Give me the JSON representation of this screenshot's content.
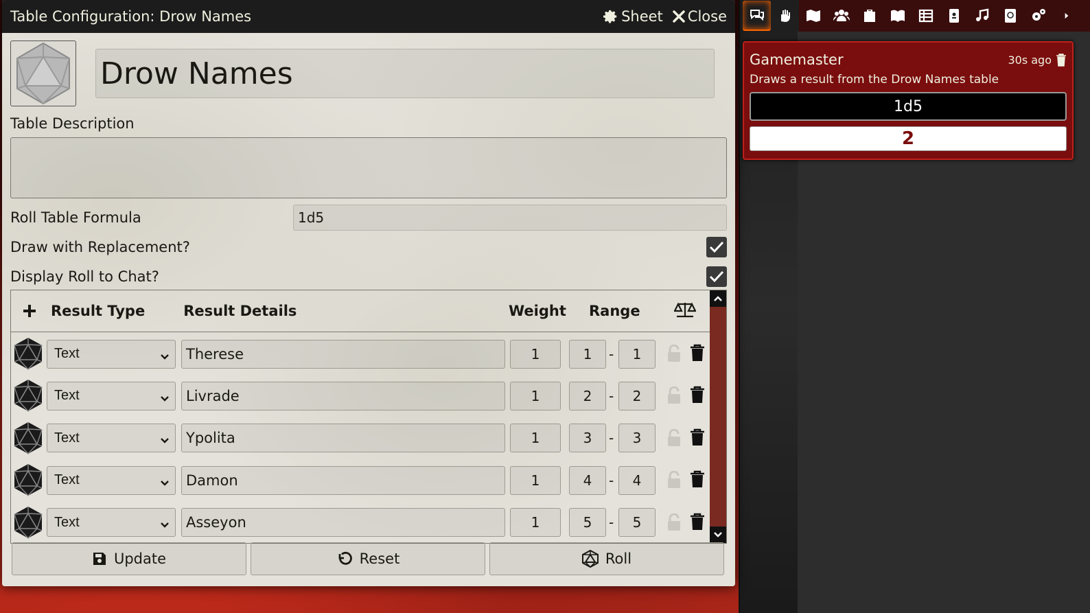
{
  "window": {
    "title": "Table Configuration: Drow Names",
    "sheet_label": "Sheet",
    "close_label": "Close"
  },
  "table": {
    "name": "Drow Names",
    "description_label": "Table Description",
    "description": "",
    "formula_label": "Roll Table Formula",
    "formula": "1d5",
    "replacement_label": "Draw with Replacement?",
    "replacement_checked": true,
    "display_roll_label": "Display Roll to Chat?",
    "display_roll_checked": true
  },
  "results_header": {
    "type": "Result Type",
    "details": "Result Details",
    "weight": "Weight",
    "range": "Range"
  },
  "results": [
    {
      "type": "Text",
      "detail": "Therese",
      "weight": "1",
      "low": "1",
      "high": "1"
    },
    {
      "type": "Text",
      "detail": "Livrade",
      "weight": "1",
      "low": "2",
      "high": "2"
    },
    {
      "type": "Text",
      "detail": "Ypolita",
      "weight": "1",
      "low": "3",
      "high": "3"
    },
    {
      "type": "Text",
      "detail": "Damon",
      "weight": "1",
      "low": "4",
      "high": "4"
    },
    {
      "type": "Text",
      "detail": "Asseyon",
      "weight": "1",
      "low": "5",
      "high": "5"
    }
  ],
  "footer": {
    "update_label": "Update",
    "reset_label": "Reset",
    "roll_label": "Roll"
  },
  "chat": {
    "sender": "Gamemaster",
    "timestamp": "30s ago",
    "flavor": "Draws a result from the Drow Names table",
    "formula": "1d5",
    "total": "2"
  },
  "sidebar_tabs": [
    "chat-icon",
    "combat-icon",
    "scenes-icon",
    "actors-icon",
    "items-icon",
    "journal-icon",
    "tables-icon",
    "cards-icon",
    "playlists-icon",
    "compendium-icon",
    "settings-icon",
    "collapse-icon"
  ],
  "colors": {
    "chat_bg": "#7a0d0d",
    "accent": "#ff6400",
    "window_bg": "#e4e2da"
  }
}
